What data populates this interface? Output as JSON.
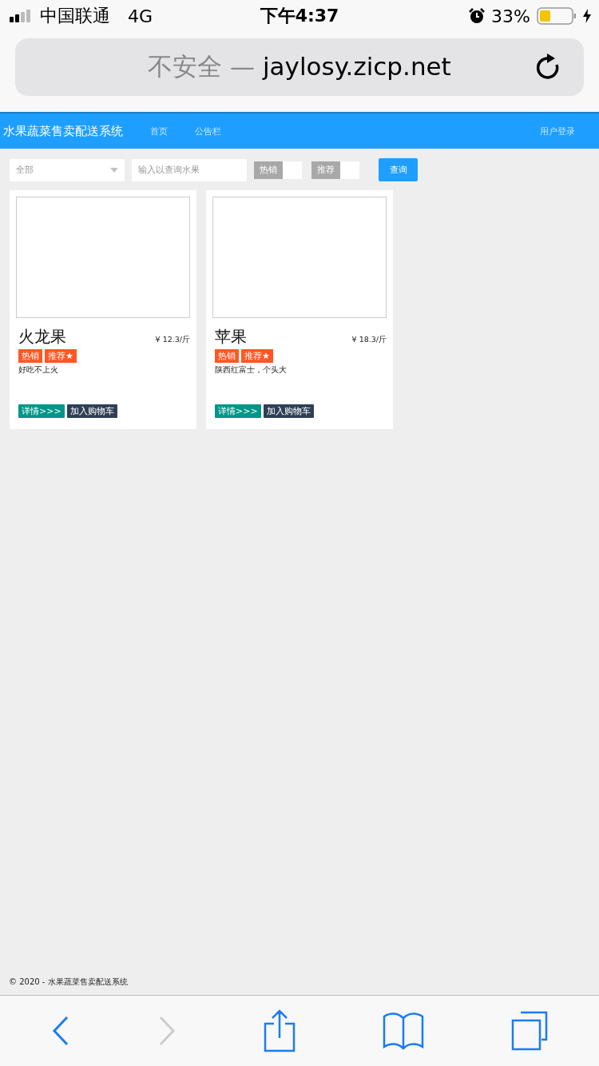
{
  "status_bar": {
    "carrier": "中国联通",
    "network": "4G",
    "time": "下午4:37",
    "battery_text": "33%"
  },
  "address_bar": {
    "security": "不安全 —",
    "domain": "jaylosy.zicp.net"
  },
  "nav": {
    "brand": "水果蔬菜售卖配送系统",
    "links": [
      {
        "label": "首页",
        "selected": false
      },
      {
        "label": "公告栏",
        "selected": false
      }
    ],
    "login": "用户登录"
  },
  "filters": {
    "category": "全部",
    "search_placeholder": "输入以查询水果",
    "switches": [
      {
        "label": "热销",
        "on": false
      },
      {
        "label": "推荐",
        "on": false
      }
    ],
    "query_button": "查询"
  },
  "products": [
    {
      "name": "火龙果",
      "price": "¥ 12.3/斤",
      "tags": [
        "热销",
        "推荐★"
      ],
      "description": "好吃不上火",
      "buttons": [
        "详情>>>",
        "加入购物车"
      ]
    },
    {
      "name": "苹果",
      "price": "¥ 18.3/斤",
      "tags": [
        "热销",
        "推荐★"
      ],
      "description": "陕西红富士，个头大",
      "buttons": [
        "详情>>>",
        "加入购物车"
      ]
    }
  ],
  "footer": "© 2020 - 水果蔬菜售卖配送系统",
  "toolbar": {
    "back_enabled": true,
    "forward_enabled": false
  }
}
